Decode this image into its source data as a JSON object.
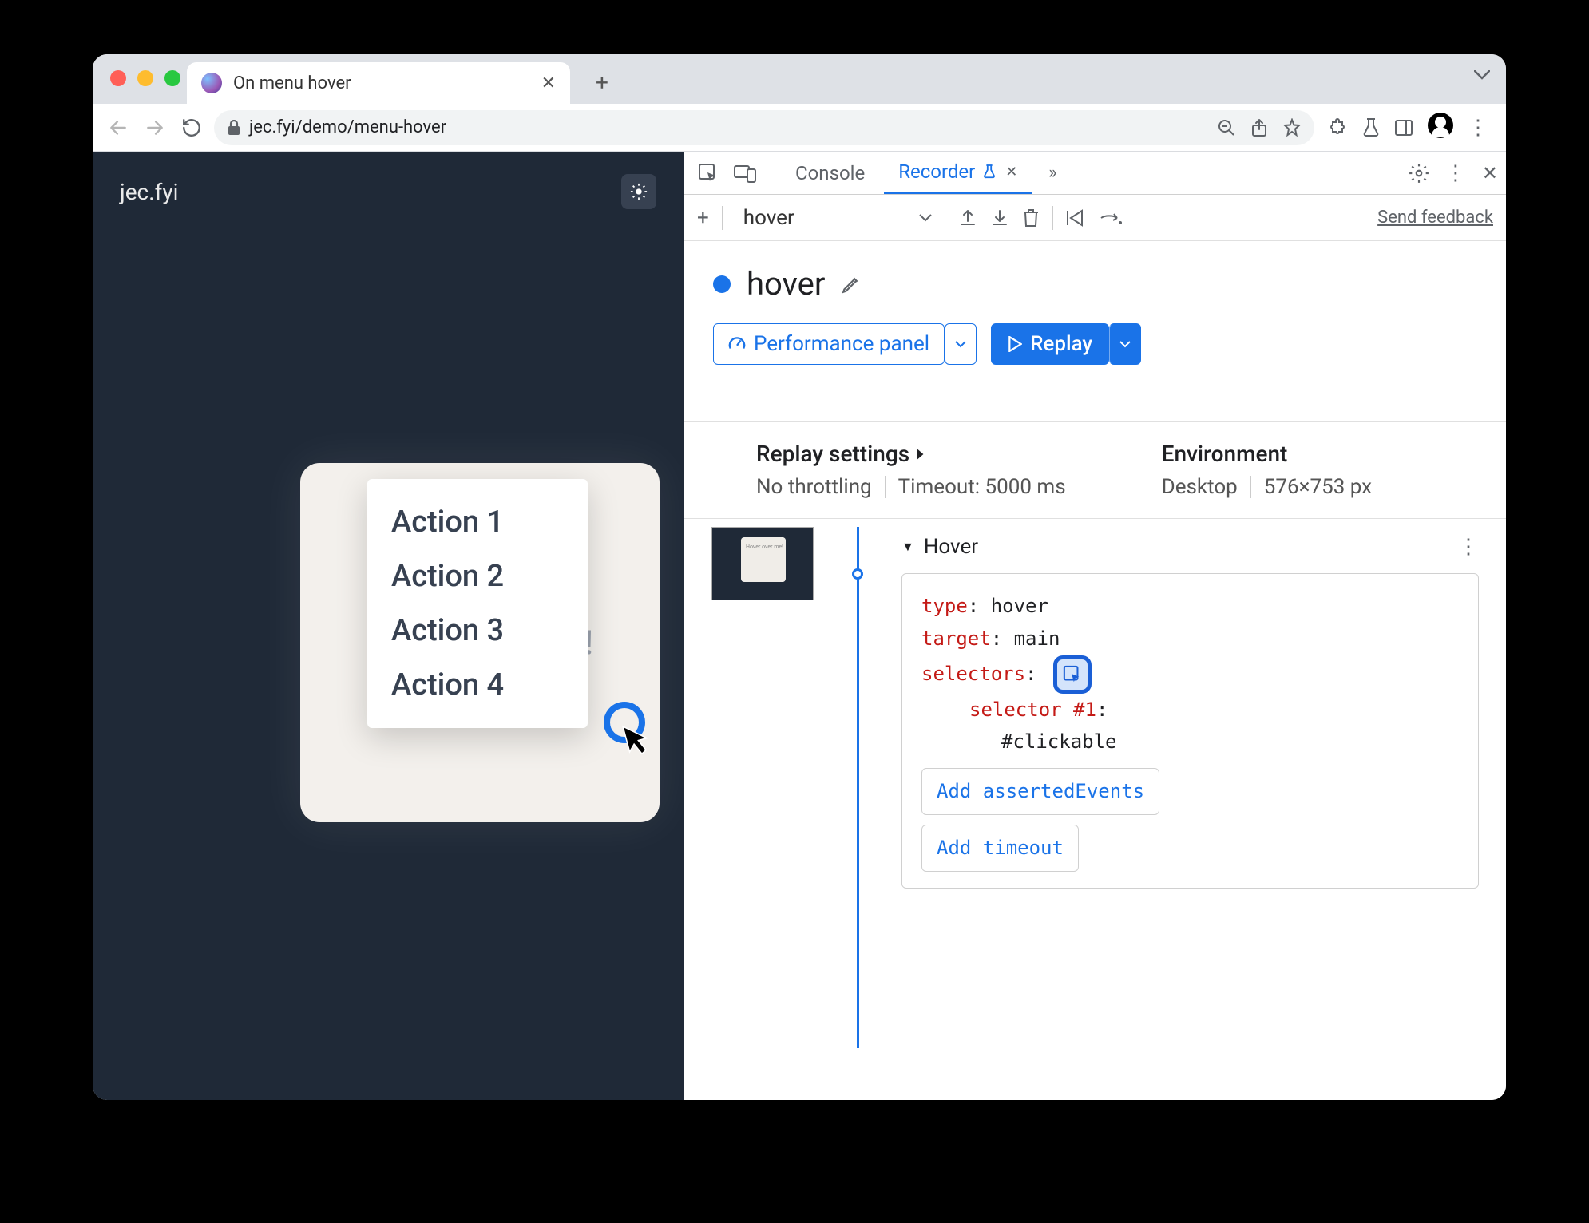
{
  "tab": {
    "title": "On menu hover"
  },
  "url": "jec.fyi/demo/menu-hover",
  "page": {
    "site_name": "jec.fyi",
    "card_bg_text": "Hover over me!",
    "menu_items": [
      "Action 1",
      "Action 2",
      "Action 3",
      "Action 4"
    ]
  },
  "devtools": {
    "tabs": {
      "console": "Console",
      "recorder": "Recorder"
    },
    "recorder": {
      "selected_recording": "hover",
      "feedback": "Send feedback",
      "title": "hover",
      "performance_btn": "Performance panel",
      "replay_btn": "Replay",
      "replay_settings": {
        "label": "Replay settings",
        "throttling": "No throttling",
        "timeout": "Timeout: 5000 ms"
      },
      "environment": {
        "label": "Environment",
        "device": "Desktop",
        "viewport": "576×753 px"
      },
      "step": {
        "name": "Hover",
        "props": {
          "type_key": "type",
          "type_val": "hover",
          "target_key": "target",
          "target_val": "main",
          "selectors_key": "selectors",
          "selector_label": "selector #1",
          "selector_val": "#clickable"
        },
        "add_asserted": "Add assertedEvents",
        "add_timeout": "Add timeout"
      }
    }
  }
}
